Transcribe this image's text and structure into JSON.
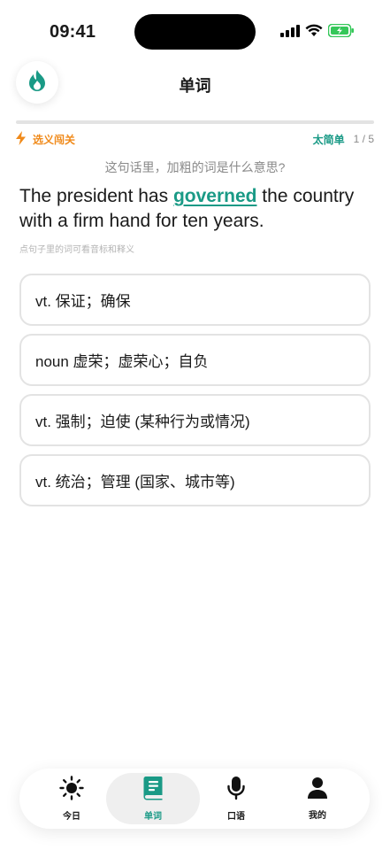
{
  "status": {
    "time": "09:41"
  },
  "header": {
    "title": "单词"
  },
  "progress": {
    "fraction": 0.0
  },
  "mode": {
    "label": "选义闯关",
    "too_easy": "太简单",
    "counter": "1 / 5"
  },
  "question": "这句话里，加粗的词是什么意思?",
  "sentence": {
    "before": "The president has ",
    "highlight": "governed",
    "after": " the country with a firm hand for ten years."
  },
  "hint": "点句子里的词可看音标和释义",
  "options": [
    {
      "label": "vt. 保证；确保"
    },
    {
      "label": "noun 虚荣；虚荣心；自负"
    },
    {
      "label": "vt. 强制；迫使 (某种行为或情况)"
    },
    {
      "label": "vt. 统治；管理 (国家、城市等)"
    }
  ],
  "tabs": [
    {
      "label": "今日",
      "icon": "sun-icon",
      "active": false
    },
    {
      "label": "单词",
      "icon": "book-icon",
      "active": true
    },
    {
      "label": "口语",
      "icon": "microphone-icon",
      "active": false
    },
    {
      "label": "我的",
      "icon": "person-icon",
      "active": false
    }
  ],
  "colors": {
    "accent": "#1a9a86",
    "mode": "#f08a1a"
  }
}
